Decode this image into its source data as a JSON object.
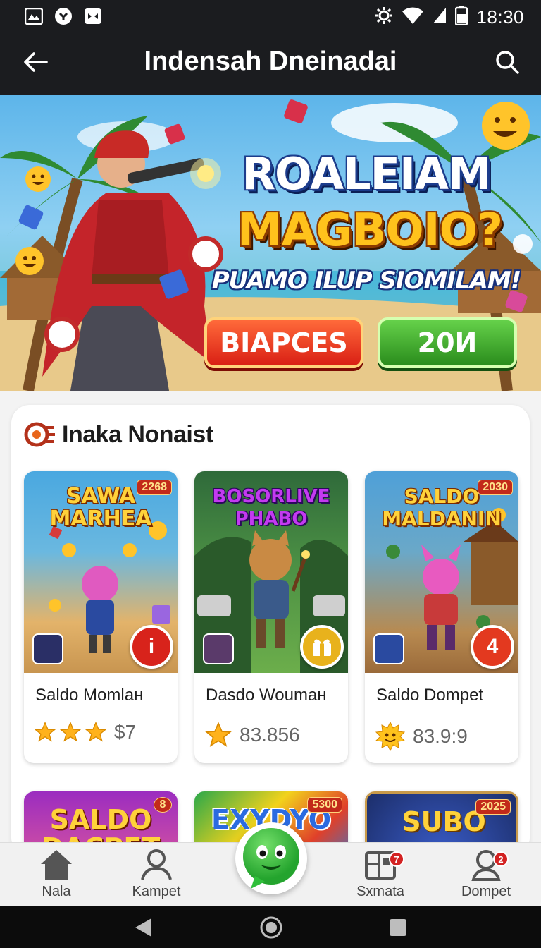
{
  "status_bar": {
    "time": "18:30",
    "icons": [
      "gallery-icon",
      "notification-dot-icon",
      "media-icon",
      "settings-icon",
      "wifi-icon",
      "signal-icon",
      "battery-icon"
    ]
  },
  "app_bar": {
    "title": "Indensah Dneinadai",
    "back_icon": "arrow-left-icon",
    "search_icon": "search-icon"
  },
  "banner": {
    "headline_1": "ROALEIAM",
    "headline_2": "MAGBOIO?",
    "subline": "PUAMO ILUP SIOMILAM!",
    "primary_button": "BIAPCES",
    "secondary_button": "20И"
  },
  "section": {
    "title": "Inaka Nonaist",
    "icon": "fire-logo-icon",
    "games": [
      {
        "art_title": "SAWA MARHEA",
        "badge": "2268",
        "name": "Saldo Momlaн",
        "rating_icon": "star-icon",
        "stars": 3,
        "rating_text": "$7",
        "action_icon": "info-icon",
        "action_text": "i",
        "action_color": "#d8231b",
        "art_bg_top": "#4aa8e0",
        "art_bg_bottom": "#e3b36a"
      },
      {
        "art_title": "BOSORLIVE PHABO",
        "badge": "",
        "name": "Dasdo Woumaн",
        "rating_icon": "star-icon",
        "stars": 1,
        "rating_text": "83.856",
        "action_icon": "gift-icon",
        "action_text": "",
        "action_color": "#e8b21c",
        "art_bg_top": "#3f8a3a",
        "art_bg_bottom": "#6cae4b"
      },
      {
        "art_title": "SALDO MALDANIN",
        "badge": "2030",
        "name": "Saldo Dompet",
        "rating_icon": "sun-badge-icon",
        "stars": 1,
        "rating_text": "83.9:9",
        "action_icon": "count-badge-icon",
        "action_text": "4",
        "action_color": "#e3391f",
        "art_bg_top": "#4fa0d8",
        "art_bg_bottom": "#c28b4e"
      }
    ],
    "more_games": [
      {
        "title": "SALDO DACPET",
        "badge": "8",
        "bg_from": "#9b2cc0",
        "bg_to": "#e05a9a",
        "color": "#ffd23a"
      },
      {
        "title": "EXYDYO",
        "badge": "5300",
        "bg_from": "#f2d21c",
        "bg_to": "#2aa84a",
        "color": "#2b6be0"
      },
      {
        "title": "SUBO",
        "badge": "2025",
        "bg_from": "#1c2e6a",
        "bg_to": "#3a5cc8",
        "color": "#ffd23a"
      }
    ]
  },
  "bottom_nav": {
    "items": [
      {
        "label": "Nala",
        "icon": "home-icon",
        "badge": ""
      },
      {
        "label": "Kampet",
        "icon": "person-icon",
        "badge": ""
      },
      {
        "label": "Sxmata",
        "icon": "dashboard-icon",
        "badge": "7"
      },
      {
        "label": "Dompet",
        "icon": "wallet-person-icon",
        "badge": "2"
      }
    ],
    "center_icon": "green-chat-mascot-icon"
  },
  "system_nav": [
    "back-triangle-icon",
    "home-circle-icon",
    "recents-square-icon"
  ]
}
